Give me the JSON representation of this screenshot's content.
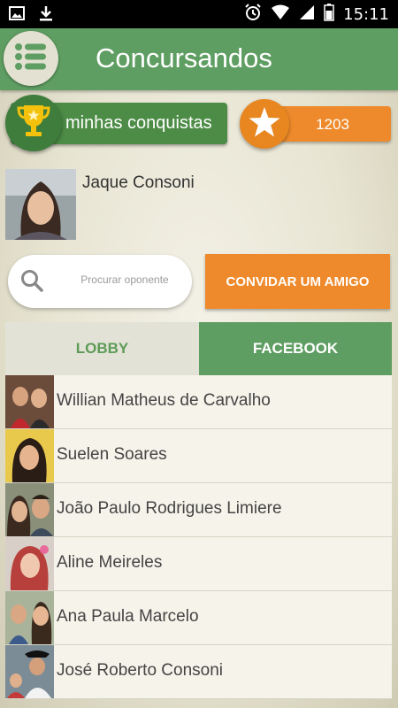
{
  "status_bar": {
    "time": "15:11",
    "icons": [
      "image-icon",
      "download-icon",
      "alarm-icon",
      "wifi-icon",
      "signal-icon",
      "battery-icon"
    ]
  },
  "app_bar": {
    "title": "Concursandos",
    "menu_icon": "list-menu-icon"
  },
  "achievements": {
    "label": "minhas conquistas",
    "icon": "trophy-icon"
  },
  "score": {
    "value": "1203",
    "icon": "star-icon"
  },
  "user": {
    "name": "Jaque Consoni"
  },
  "search": {
    "placeholder": "Procurar oponente"
  },
  "invite_button": {
    "label": "CONVIDAR UM AMIGO"
  },
  "tabs": [
    {
      "label": "LOBBY",
      "selected": false
    },
    {
      "label": "FACEBOOK",
      "selected": true
    }
  ],
  "friends": [
    {
      "name": "Willian Matheus de Carvalho"
    },
    {
      "name": "Suelen Soares"
    },
    {
      "name": "João Paulo Rodrigues Limiere"
    },
    {
      "name": "Aline Meireles"
    },
    {
      "name": "Ana Paula Marcelo"
    },
    {
      "name": "José Roberto Consoni"
    }
  ],
  "colors": {
    "primary_green": "#5f9e62",
    "dark_green": "#4c8c46",
    "orange": "#ee8a2b",
    "tab_inactive": "#e3e2d6"
  }
}
